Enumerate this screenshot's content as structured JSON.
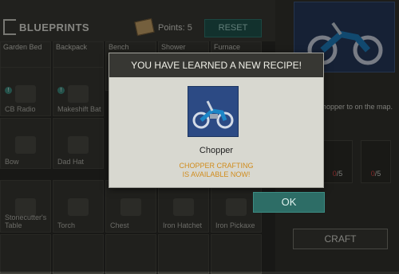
{
  "header": {
    "title": "BLUEPRINTS",
    "points_label": "Points:",
    "points_value": "5",
    "reset_label": "RESET"
  },
  "grid": {
    "row0_top_labels": [
      "Garden Bed",
      "Backpack",
      "Bench",
      "Shower",
      "Furnace"
    ],
    "row1": [
      "CB Radio",
      "Makeshift Bat"
    ],
    "row2": [
      "Bow",
      "Dad Hat"
    ],
    "row3": [
      "Stonecutter's Table",
      "Torch",
      "Chest",
      "Iron Hatchet",
      "Iron Pickaxe"
    ]
  },
  "right_panel": {
    "description": "to build a Chopper to on the map.",
    "resources": [
      {
        "have": "0",
        "need": "/5"
      },
      {
        "have": "0",
        "need": "/5"
      }
    ],
    "craft_label": "CRAFT"
  },
  "modal": {
    "title": "YOU HAVE LEARNED A NEW RECIPE!",
    "recipe_name": "Chopper",
    "message_line1": "CHOPPER CRAFTING",
    "message_line2": "IS AVAILABLE NOW!",
    "ok_label": "OK"
  }
}
